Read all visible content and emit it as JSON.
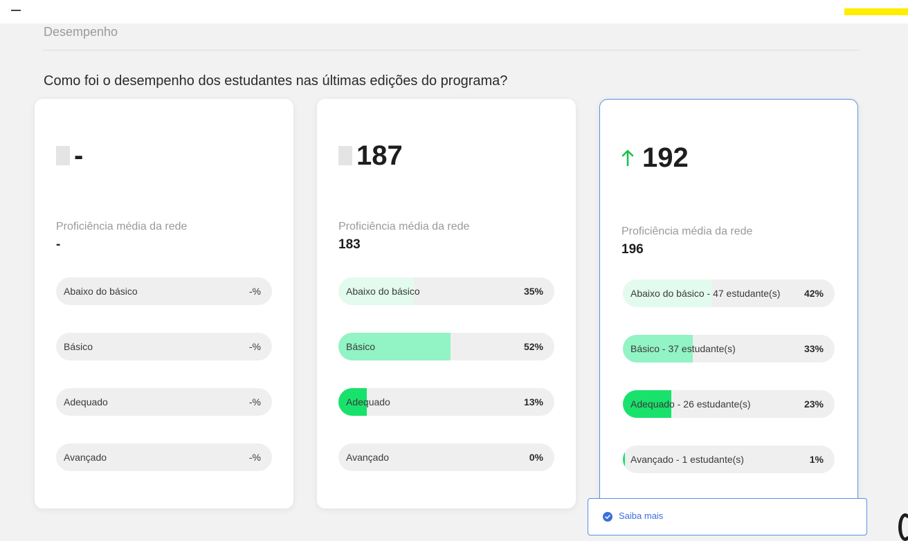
{
  "colors": {
    "fill_light": "#e3fbee",
    "fill_medium": "#92f3c5",
    "fill_strong": "#19e26c",
    "trend_up": "#1bbf4f",
    "accent": "#5c8de6"
  },
  "section": {
    "title": "Desempenho"
  },
  "question": "Como foi o desempenho dos estudantes nas últimas edições do programa?",
  "cards": [
    {
      "headline": "-",
      "trend_icon": "neutral-indicator",
      "proficiency_label": "Proficiência média da rede",
      "proficiency_value": "-",
      "levels": [
        {
          "label": "Abaixo do básico",
          "pct_text": "-%",
          "fill_pct": 0
        },
        {
          "label": "Básico",
          "pct_text": "-%",
          "fill_pct": 0
        },
        {
          "label": "Adequado",
          "pct_text": "-%",
          "fill_pct": 0
        },
        {
          "label": "Avançado",
          "pct_text": "-%",
          "fill_pct": 0
        }
      ]
    },
    {
      "headline": "187",
      "trend_icon": "neutral-indicator",
      "proficiency_label": "Proficiência média da rede",
      "proficiency_value": "183",
      "levels": [
        {
          "label": "Abaixo do básico",
          "pct_text": "35%",
          "fill_pct": 35
        },
        {
          "label": "Básico",
          "pct_text": "52%",
          "fill_pct": 52
        },
        {
          "label": "Adequado",
          "pct_text": "13%",
          "fill_pct": 13
        },
        {
          "label": "Avançado",
          "pct_text": "0%",
          "fill_pct": 0
        }
      ]
    },
    {
      "headline": "192",
      "trend_icon": "arrow-up-icon",
      "proficiency_label": "Proficiência média da rede",
      "proficiency_value": "196",
      "levels": [
        {
          "label": "Abaixo do básico - 47 estudante(s)",
          "pct_text": "42%",
          "fill_pct": 42
        },
        {
          "label": "Básico - 37 estudante(s)",
          "pct_text": "33%",
          "fill_pct": 33
        },
        {
          "label": "Adequado - 26 estudante(s)",
          "pct_text": "23%",
          "fill_pct": 23
        },
        {
          "label": "Avançado - 1 estudante(s)",
          "pct_text": "1%",
          "fill_pct": 1
        }
      ]
    }
  ],
  "saiba_mais": {
    "label": "Saiba mais",
    "icon": "info-circle-icon"
  }
}
